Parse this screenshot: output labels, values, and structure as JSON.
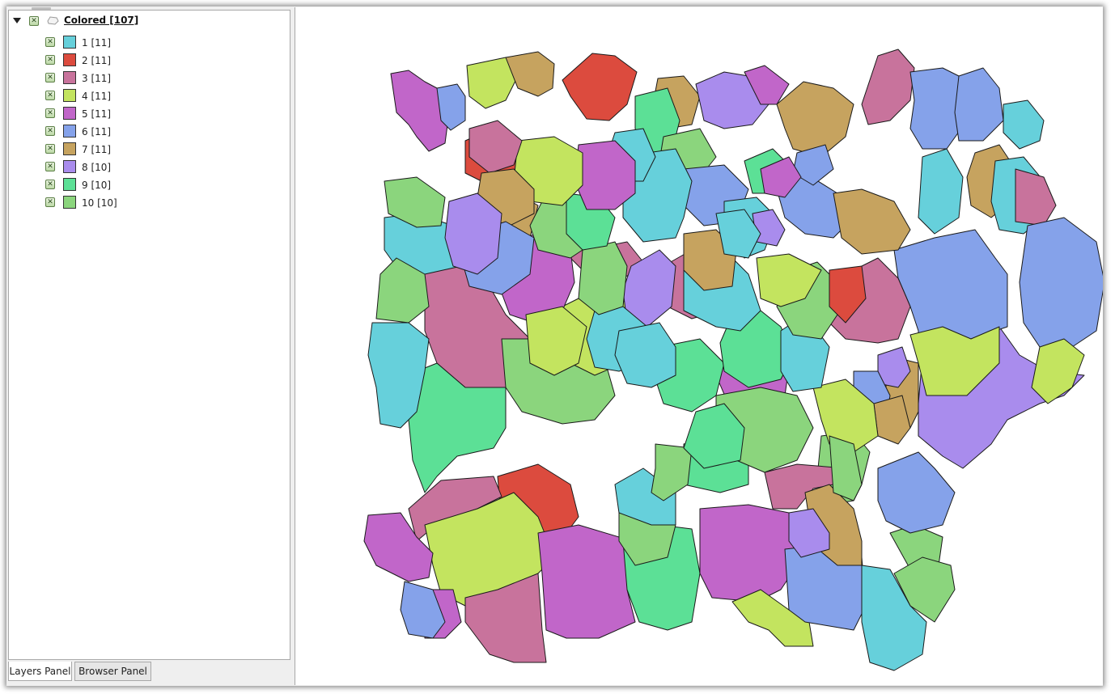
{
  "panels": {
    "tabs": [
      {
        "label": "Layers Panel",
        "active": true
      },
      {
        "label": "Browser Panel",
        "active": false
      }
    ]
  },
  "layer": {
    "name": "Colored [107]",
    "expanded": true,
    "checked": true,
    "icon": "polygon-layer-icon",
    "classes": [
      {
        "label": "1 [11]",
        "color": "#66d0db",
        "checked": true
      },
      {
        "label": "2 [11]",
        "color": "#dc4b3e",
        "checked": true
      },
      {
        "label": "3 [11]",
        "color": "#c8739c",
        "checked": true
      },
      {
        "label": "4 [11]",
        "color": "#c3e45f",
        "checked": true
      },
      {
        "label": "5 [11]",
        "color": "#c166c9",
        "checked": true
      },
      {
        "label": "6 [11]",
        "color": "#85a2ea",
        "checked": true
      },
      {
        "label": "7 [11]",
        "color": "#c6a35f",
        "checked": true
      },
      {
        "label": "8 [10]",
        "color": "#a98ced",
        "checked": true
      },
      {
        "label": "9 [10]",
        "color": "#5ce096",
        "checked": true
      },
      {
        "label": "10 [10]",
        "color": "#8bd57d",
        "checked": true
      }
    ]
  },
  "icons": {
    "checkbox_mark": "✕"
  }
}
